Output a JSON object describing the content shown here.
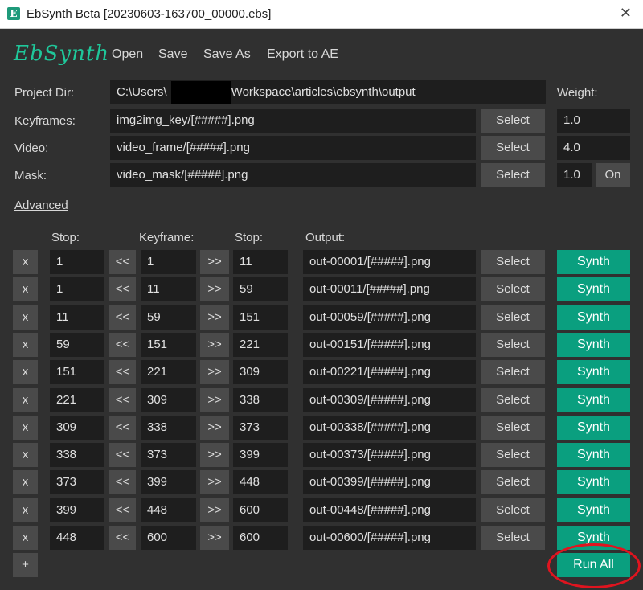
{
  "window": {
    "title": "EbSynth Beta [20230603-163700_00000.ebs]",
    "app_icon": "E",
    "close_glyph": "✕"
  },
  "logo": "EbSynth",
  "menu": {
    "open": "Open",
    "save": "Save",
    "save_as": "Save As",
    "export": "Export to AE"
  },
  "project": {
    "dir_label": "Project Dir:",
    "dir_prefix": "C:\\Users\\",
    "dir_suffix": "\\Workspace\\articles\\ebsynth\\output",
    "weight_label": "Weight:",
    "keyframes_label": "Keyframes:",
    "keyframes_value": "img2img_key/[#####].png",
    "keyframes_weight": "1.0",
    "video_label": "Video:",
    "video_value": "video_frame/[#####].png",
    "video_weight": "4.0",
    "mask_label": "Mask:",
    "mask_value": "video_mask/[#####].png",
    "mask_weight": "1.0",
    "mask_toggle": "On",
    "select_label": "Select"
  },
  "advanced_label": "Advanced",
  "table": {
    "headers": {
      "stop1": "Stop:",
      "keyframe": "Keyframe:",
      "stop2": "Stop:",
      "output": "Output:"
    },
    "remove_label": "x",
    "prev_label": "<<",
    "next_label": ">>",
    "select_label": "Select",
    "synth_label": "Synth",
    "rows": [
      {
        "stop1": "1",
        "key": "1",
        "stop2": "11",
        "output": "out-00001/[#####].png"
      },
      {
        "stop1": "1",
        "key": "11",
        "stop2": "59",
        "output": "out-00011/[#####].png"
      },
      {
        "stop1": "11",
        "key": "59",
        "stop2": "151",
        "output": "out-00059/[#####].png"
      },
      {
        "stop1": "59",
        "key": "151",
        "stop2": "221",
        "output": "out-00151/[#####].png"
      },
      {
        "stop1": "151",
        "key": "221",
        "stop2": "309",
        "output": "out-00221/[#####].png"
      },
      {
        "stop1": "221",
        "key": "309",
        "stop2": "338",
        "output": "out-00309/[#####].png"
      },
      {
        "stop1": "309",
        "key": "338",
        "stop2": "373",
        "output": "out-00338/[#####].png"
      },
      {
        "stop1": "338",
        "key": "373",
        "stop2": "399",
        "output": "out-00373/[#####].png"
      },
      {
        "stop1": "373",
        "key": "399",
        "stop2": "448",
        "output": "out-00399/[#####].png"
      },
      {
        "stop1": "399",
        "key": "448",
        "stop2": "600",
        "output": "out-00448/[#####].png"
      },
      {
        "stop1": "448",
        "key": "600",
        "stop2": "600",
        "output": "out-00600/[#####].png"
      }
    ]
  },
  "add_label": "+",
  "run_all_label": "Run All",
  "colors": {
    "background": "#303030",
    "field": "#1e1e1e",
    "button": "#4a4a4a",
    "accent": "#0a9f7f",
    "annotation": "#e0141f"
  }
}
